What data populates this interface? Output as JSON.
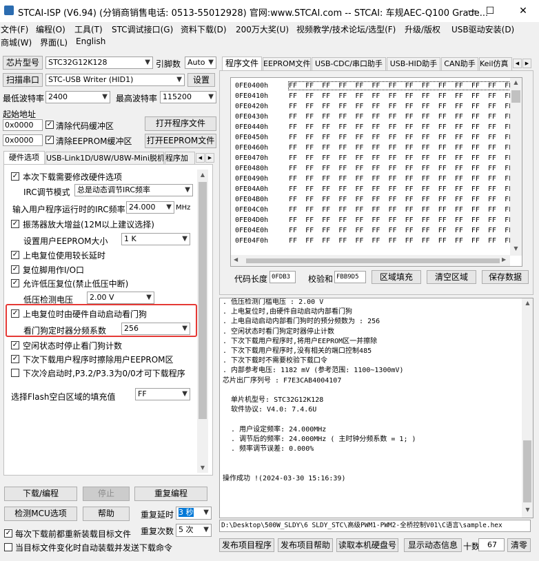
{
  "window": {
    "title": "STCAI-ISP (V6.94) (分销商销售电话: 0513-55012928) 官网:www.STCAI.com  -- STCAI: 车规AEC-Q100 Grade...",
    "btn_min": "—",
    "btn_max": "☐",
    "btn_close": "✕"
  },
  "menu": [
    "文件(F)",
    "编程(O)",
    "工具(T)",
    "STC调试接口(G)",
    "资料下载(D)",
    "200万大奖(U)",
    "视频教学/技术论坛/选型(F)",
    "升级/版权",
    "USB驱动安装(D)"
  ],
  "menu2": [
    "商城(W)",
    "界面(L)",
    "English"
  ],
  "left": {
    "chip_label": "芯片型号",
    "chip_value": "STC32G12K128",
    "pin_label": "引脚数",
    "pin_value": "Auto",
    "scan_button": "扫描串口",
    "port_value": "STC-USB Writer (HID1)",
    "settings_button": "设置",
    "min_baud_label": "最低波特率",
    "min_baud_value": "2400",
    "max_baud_label": "最高波特率",
    "max_baud_value": "115200",
    "start_addr_label": "起始地址",
    "addr1": "0x0000",
    "clear_code_label": "清除代码缓冲区",
    "open_program_button": "打开程序文件",
    "addr2": "0x0000",
    "clear_eeprom_label": "清除EEPROM缓冲区",
    "open_eeprom_button": "打开EEPROM文件",
    "tabs": [
      "硬件选项",
      "USB-Link1D/U8W/U8W-Mini脱机",
      "程序加"
    ],
    "opt_modify_hw": "本次下载需要修改硬件选项",
    "irc_mode_label": "IRC调节模式",
    "irc_mode_value": "总是动态调节IRC频率",
    "irc_freq_label": "输入用户程序运行时的IRC频率",
    "irc_freq_value": "24.000",
    "irc_freq_unit": "MHz",
    "opt_osc_gain": "振荡器放大增益(12M以上建议选择)",
    "eeprom_size_label": "设置用户EEPROM大小",
    "eeprom_size_value": "1    K",
    "opt_long_delay": "上电复位使用较长延时",
    "opt_reset_io": "复位脚用作I/O口",
    "opt_lvd_reset": "允许低压复位(禁止低压中断)",
    "lvd_label": "低压检测电压",
    "lvd_value": "2.00 V",
    "opt_wdt": "上电复位时由硬件自动启动看门狗",
    "wdt_div_label": "看门狗定时器分频系数",
    "wdt_div_value": "256",
    "opt_idle_wdt": "空闲状态时停止看门狗计数",
    "opt_erase_eeprom": "下次下载用户程序时擦除用户EEPROM区",
    "opt_cold_boot": "下次冷启动时,P3.2/P3.3为0/0才可下载程序",
    "fill_label": "选择Flash空白区域的填充值",
    "fill_value": "FF",
    "download_button": "下载/编程",
    "stop_button": "停止",
    "reprogram_button": "重复编程",
    "detect_button": "检测MCU选项",
    "help_button": "帮助",
    "repeat_delay_label": "重复延时",
    "repeat_delay_value": "3 秒",
    "repeat_count_label": "重复次数",
    "repeat_count_value": "5 次",
    "opt_reload_each": "每次下载前都重新装载目标文件",
    "opt_auto_send": "当目标文件变化时自动装载并发送下载命令"
  },
  "right": {
    "tabs": [
      "程序文件",
      "EEPROM文件",
      "USB-CDC/串口助手",
      "USB-HID助手",
      "CAN助手",
      "Keil仿真"
    ],
    "hex_rows": [
      "0FE0400h",
      "0FE0410h",
      "0FE0420h",
      "0FE0430h",
      "0FE0440h",
      "0FE0450h",
      "0FE0460h",
      "0FE0470h",
      "0FE0480h",
      "0FE0490h",
      "0FE04A0h",
      "0FE04B0h",
      "0FE04C0h",
      "0FE04D0h",
      "0FE04E0h",
      "0FE04F0h"
    ],
    "hex_bytes": "FF  FF  FF  FF  FF  FF  FF  FF  FF  FF  FF  FF  FF  FF  FF  F",
    "code_len_label": "代码长度",
    "code_len_value": "0FDB3",
    "checksum_label": "校验和",
    "checksum_value": "FBB9D5",
    "fill_button": "区域填充",
    "clear_button": "清空区域",
    "save_button": "保存数据",
    "log_lines": [
      ". 低压检测门槛电压 : 2.00 V",
      ". 上电复位时,由硬件自动启动内部看门狗",
      ". 上电自动启动内部看门狗时的预分频数为 : 256",
      ". 空闲状态时看门狗定时器停止计数",
      ". 下次下载用户程序时,将用户EEPROM区一并擦除",
      ". 下次下载用户程序时,没有相关的端口控制485",
      ". 下次下载时不需要校验下载口令",
      ". 内部参考电压: 1182 mV (参考范围: 1100~1300mV)",
      "芯片出厂序列号 : F7E3CAB4004107",
      "",
      "  单片机型号: STC32G12K128",
      "  软件协议: V4.0: 7.4.6U",
      "",
      "  . 用户设定频率: 24.000MHz",
      "  . 调节后的频率: 24.000MHz ( 主时钟分频系数 = 1; )",
      "  . 频率调节误差: 0.000%",
      "",
      "",
      "操作成功 !(2024-03-30 15:16:39)"
    ],
    "file_path": "D:\\Desktop\\500W_SLDY\\6 SLDY_STC\\高级PWM1-PWM2-全桥控制V01\\C语言\\sample.hex",
    "publish_button": "发布项目程序",
    "publish_help_button": "发布项目帮助",
    "read_id_button": "读取本机硬盘号",
    "show_dynamic_button": "显示动态信息",
    "count_label": "十数",
    "count_value": "67",
    "clear_count_button": "清零"
  },
  "colors": {
    "highlight": "#e53935",
    "accent": "#0078d7"
  }
}
